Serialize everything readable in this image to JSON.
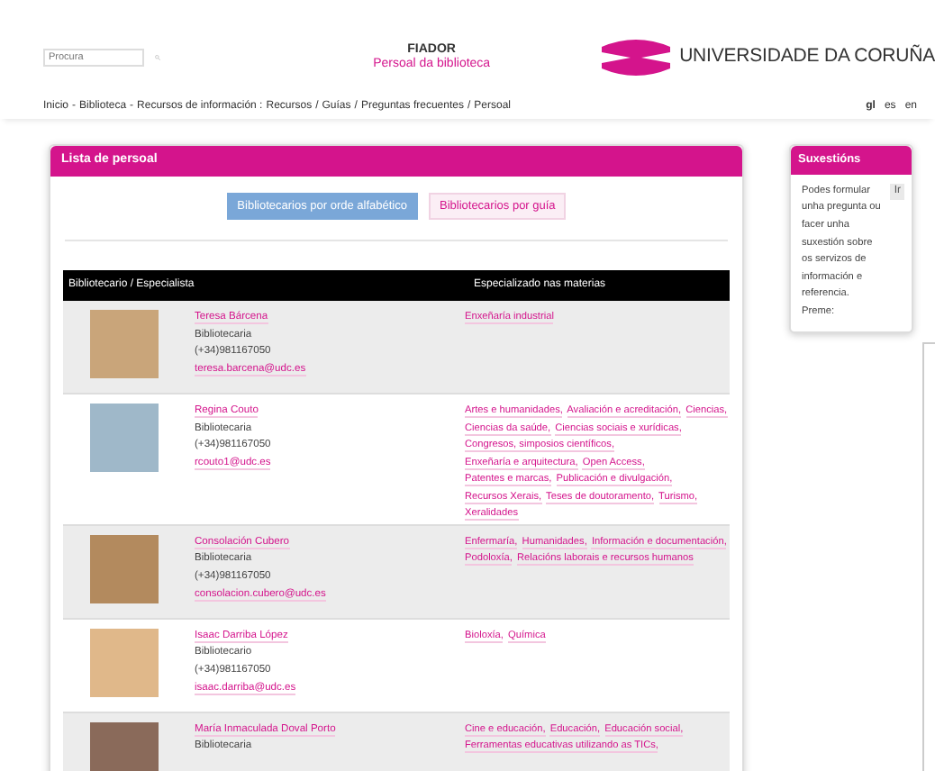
{
  "header": {
    "search": {
      "placeholder": "Procura"
    },
    "site_title": "FIADOR",
    "site_subtitle": "Persoal da biblioteca",
    "logo_text": "UNIVERSIDADE DA CORUÑA"
  },
  "breadcrumb": [
    "Inicio",
    "-",
    "Biblioteca",
    "-",
    "Recursos de información :",
    "Recursos",
    "/",
    "Guías",
    "/",
    "Preguntas frecuentes",
    "/",
    "Persoal"
  ],
  "languages": [
    {
      "label": "gl",
      "selected": true
    },
    {
      "label": "es",
      "selected": false
    },
    {
      "label": "en",
      "selected": false
    }
  ],
  "staff_panel": {
    "title": "Lista de persoal",
    "tabs": [
      {
        "label": "Bibliotecarios por orde alfabético",
        "selected": true
      },
      {
        "label": "Bibliotecarios por guía",
        "selected": false
      }
    ],
    "columns": [
      "Bibliotecario / Especialista",
      "Especializado nas materias"
    ],
    "rows": [
      {
        "name": "Teresa Bárcena",
        "role": "Bibliotecaria",
        "phone": "(+34)981167050",
        "email": "teresa.barcena@udc.es",
        "subjects": [
          "Enxeñaría industrial"
        ]
      },
      {
        "name": "Regina Couto",
        "role": "Bibliotecaria",
        "phone": "(+34)981167050",
        "email": "rcouto1@udc.es",
        "subjects": [
          "Artes e humanidades,",
          "Avaliación e acreditación,",
          "Ciencias,",
          "Ciencias da saúde,",
          "Ciencias sociais e xurídicas,",
          "Congresos, simposios científicos,",
          "Enxeñaría e arquitectura,",
          "Open Access,",
          "Patentes e marcas,",
          "Publicación e divulgación,",
          "Recursos Xerais,",
          "Teses de doutoramento,",
          "Turismo,",
          "Xeralidades"
        ]
      },
      {
        "name": "Consolación Cubero",
        "role": "Bibliotecaria",
        "phone": "(+34)981167050",
        "email": "consolacion.cubero@udc.es",
        "subjects": [
          "Enfermaría,",
          "Humanidades,",
          "Información e documentación,",
          "Podoloxía,",
          "Relacións laborais e recursos humanos"
        ]
      },
      {
        "name": "Isaac Darriba López",
        "role": "Bibliotecario",
        "phone": "(+34)981167050",
        "email": "isaac.darriba@udc.es",
        "subjects": [
          "Bioloxía,",
          "Química"
        ]
      },
      {
        "name": "María Inmaculada Doval Porto",
        "role": "Bibliotecaria",
        "subjects": [
          "Cine e educación,",
          "Educación,",
          "Educación social,",
          "Ferramentas educativas utilizando as TICs,"
        ]
      }
    ]
  },
  "suggestions": {
    "title": "Suxestións",
    "text": "Podes formular unha pregunta ou facer unha suxestión sobre os servizos de información e referencia. Preme:",
    "button": "Ir"
  }
}
